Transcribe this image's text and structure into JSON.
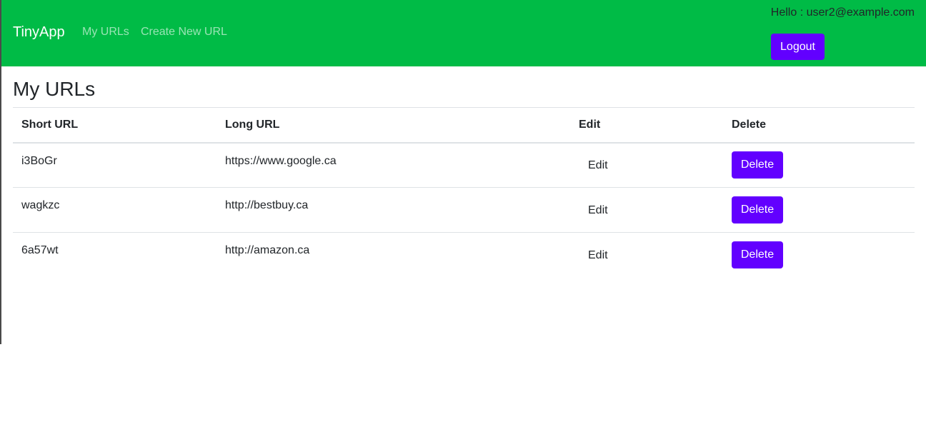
{
  "navbar": {
    "brand": "TinyApp",
    "links": [
      "My URLs",
      "Create New URL"
    ],
    "greeting": "Hello : user2@example.com",
    "logout_label": "Logout",
    "background_color": "#00bb46",
    "button_color": "#6200ff"
  },
  "main": {
    "title": "My URLs",
    "table": {
      "headers": [
        "Short URL",
        "Long URL",
        "Edit",
        "Delete"
      ],
      "rows": [
        {
          "short": "i3BoGr",
          "long": "https://www.google.ca",
          "edit": "Edit",
          "delete": "Delete"
        },
        {
          "short": "wagkzc",
          "long": "http://bestbuy.ca",
          "edit": "Edit",
          "delete": "Delete"
        },
        {
          "short": "6a57wt",
          "long": "http://amazon.ca",
          "edit": "Edit",
          "delete": "Delete"
        }
      ]
    }
  }
}
